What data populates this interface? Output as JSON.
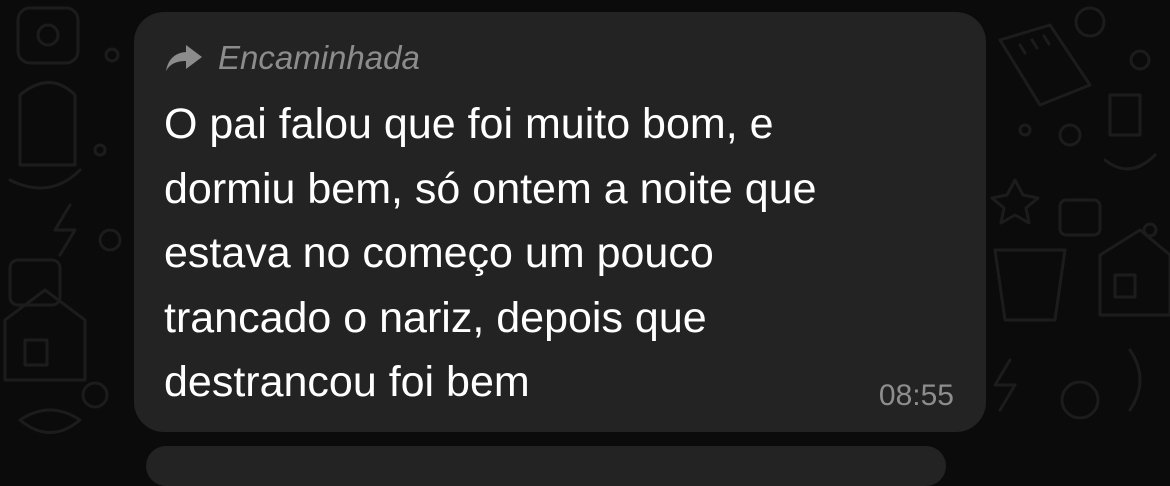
{
  "message": {
    "forwarded_label": "Encaminhada",
    "text": "O pai falou que foi muito bom, e\ndormiu bem, só ontem a noite que\nestava no começo um pouco\ntrancado o nariz, depois que\ndestrancou foi bem",
    "time": "08:55"
  },
  "icons": {
    "forward": "forward-arrow-icon"
  },
  "colors": {
    "background": "#0b0b0b",
    "bubble": "#232323",
    "text": "#ffffff",
    "meta": "#8c8c8c"
  }
}
